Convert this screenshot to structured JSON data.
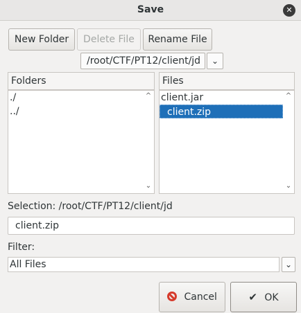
{
  "window": {
    "title": "Save"
  },
  "toolbar": {
    "new_folder_label": "New Folder",
    "delete_file_label": "Delete File",
    "rename_file_label": "Rename File"
  },
  "path_combo": {
    "value": "/root/CTF/PT12/client/jd"
  },
  "folders": {
    "header": "Folders",
    "items": [
      "./",
      "../"
    ]
  },
  "files": {
    "header": "Files",
    "items": [
      "client.jar",
      "client.zip"
    ],
    "selected": "client.zip"
  },
  "selection": {
    "label": "Selection: /root/CTF/PT12/client/jd",
    "value": "client.zip"
  },
  "filter": {
    "label": "Filter:",
    "value": "All Files"
  },
  "actions": {
    "cancel_label": "Cancel",
    "ok_label": "OK"
  },
  "colors": {
    "selection_bg": "#1e6fb8",
    "cancel_icon": "#d63b2c"
  }
}
